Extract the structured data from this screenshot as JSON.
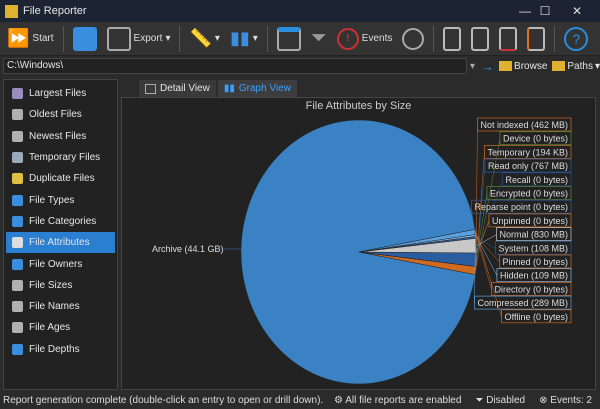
{
  "window": {
    "title": "File Reporter",
    "min": "—",
    "max": "☐",
    "close": "✕"
  },
  "toolbar": {
    "start": "Start",
    "export": "Export",
    "events": "Events"
  },
  "pathbar": {
    "path": "C:\\Windows\\",
    "browse": "Browse",
    "paths": "Paths"
  },
  "sidebar": {
    "items": [
      {
        "label": "Largest Files",
        "color": "#9a8cc0"
      },
      {
        "label": "Oldest Files",
        "color": "#b0b0b0"
      },
      {
        "label": "Newest Files",
        "color": "#b0b0b0"
      },
      {
        "label": "Temporary Files",
        "color": "#9ab"
      },
      {
        "label": "Duplicate Files",
        "color": "#e0c040"
      },
      {
        "label": "File Types",
        "color": "#3a8ee0"
      },
      {
        "label": "File Categories",
        "color": "#3a8ee0"
      },
      {
        "label": "File Attributes",
        "color": "#dddddd"
      },
      {
        "label": "File Owners",
        "color": "#3a8ee0"
      },
      {
        "label": "File Sizes",
        "color": "#b0b0b0"
      },
      {
        "label": "File Names",
        "color": "#b0b0b0"
      },
      {
        "label": "File Ages",
        "color": "#b0b0b0"
      },
      {
        "label": "File Depths",
        "color": "#3a8ee0"
      }
    ],
    "active": 7
  },
  "tabs": [
    "Detail View",
    "Graph View"
  ],
  "chart_data": {
    "type": "pie",
    "title": "File Attributes by Size",
    "slices": [
      {
        "label": "Archive (44.1 GB)",
        "value_gb": 44.1,
        "color": "#3b82c4"
      },
      {
        "label": "Not indexed (462 MB)",
        "value_gb": 0.462,
        "color": "#d06a20"
      },
      {
        "label": "Device (0 bytes)",
        "value_gb": 0,
        "color": "#5a8a3a"
      },
      {
        "label": "Temporary (194 KB)",
        "value_gb": 0.0002,
        "color": "#d06a20"
      },
      {
        "label": "Read only (767 MB)",
        "value_gb": 0.767,
        "color": "#2a5da0"
      },
      {
        "label": "Recall (0 bytes)",
        "value_gb": 0,
        "color": "#2a4a80"
      },
      {
        "label": "Encrypted (0 bytes)",
        "value_gb": 0,
        "color": "#5a8a3a"
      },
      {
        "label": "Reparse point (0 bytes)",
        "value_gb": 0,
        "color": "#2a5da0"
      },
      {
        "label": "Unpinned (0 bytes)",
        "value_gb": 0,
        "color": "#d06a20"
      },
      {
        "label": "Normal (830 MB)",
        "value_gb": 0.83,
        "color": "#c8c8c8"
      },
      {
        "label": "System (108 MB)",
        "value_gb": 0.108,
        "color": "#2a5da0"
      },
      {
        "label": "Pinned (0 bytes)",
        "value_gb": 0,
        "color": "#d06a20"
      },
      {
        "label": "Hidden (109 MB)",
        "value_gb": 0.109,
        "color": "#8ab8e8"
      },
      {
        "label": "Directory (0 bytes)",
        "value_gb": 0,
        "color": "#d06a20"
      },
      {
        "label": "Compressed (289 MB)",
        "value_gb": 0.289,
        "color": "#5aa0e0"
      },
      {
        "label": "Offline (0 bytes)",
        "value_gb": 0,
        "color": "#d06a20"
      }
    ]
  },
  "status": {
    "message": "Report generation complete (double-click an entry to open or drill down).",
    "reports": "All file reports are enabled",
    "filter": "Disabled",
    "events": "Events: 2"
  }
}
